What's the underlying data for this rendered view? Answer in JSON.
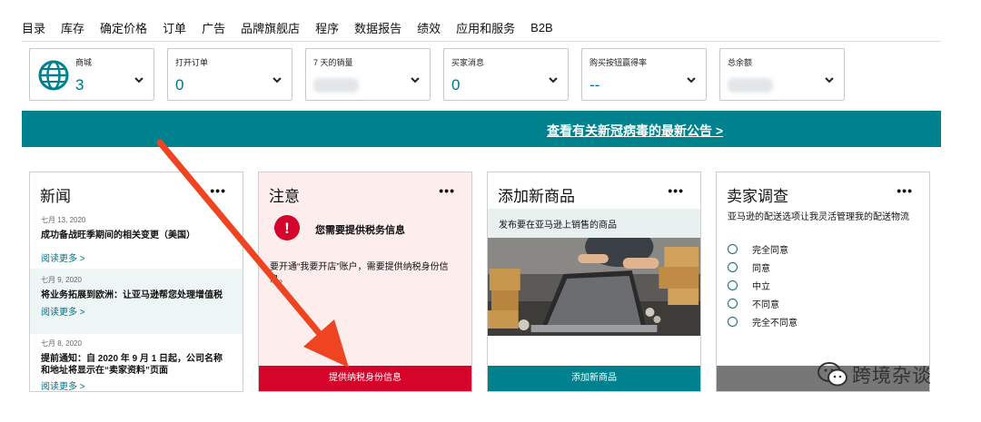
{
  "nav": {
    "items": [
      "目录",
      "库存",
      "确定价格",
      "订单",
      "广告",
      "品牌旗舰店",
      "程序",
      "数据报告",
      "绩效",
      "应用和服务",
      "B2B"
    ]
  },
  "metrics": {
    "marketplace": {
      "label": "商城",
      "value": "3"
    },
    "open_orders": {
      "label": "打开订单",
      "value": "0"
    },
    "sales_7d": {
      "label": "7 天的销量"
    },
    "buyer_messages": {
      "label": "买家消息",
      "value": "0"
    },
    "buybox": {
      "label": "购买按钮赢得率",
      "value": "--"
    },
    "balance": {
      "label": "总余额"
    }
  },
  "banner": {
    "link": "查看有关新冠病毒的最新公告 >"
  },
  "cards": {
    "news": {
      "title": "新闻",
      "dots": "•••",
      "items": [
        {
          "date": "七月 13, 2020",
          "headline": "成功备战旺季期间的相关变更（美国）",
          "link": "阅读更多 >"
        },
        {
          "date": "七月 9, 2020",
          "headline": "将业务拓展到欧洲：让亚马逊帮您处理增值税",
          "link": "阅读更多 >"
        },
        {
          "date": "七月 8, 2020",
          "headline": "提前通知：自 2020 年 9 月 1 日起，公司名称和地址将显示在“卖家资料”页面",
          "link": "阅读更多 >"
        }
      ]
    },
    "notice": {
      "title": "注意",
      "dots": "•••",
      "icon_text": "!",
      "heading": "您需要提供税务信息",
      "body": "要开通“我要开店”账户，需要提供纳税身份信息。",
      "button": "提供纳税身份信息"
    },
    "add_product": {
      "title": "添加新商品",
      "dots": "•••",
      "desc": "发布要在亚马逊上销售的商品",
      "button": "添加新商品"
    },
    "survey": {
      "title": "卖家调查",
      "dots": "•••",
      "question": "亚马逊的配送选项让我灵活管理我的配送物流",
      "options": [
        "完全同意",
        "同意",
        "中立",
        "不同意",
        "完全不同意"
      ]
    }
  },
  "colors": {
    "teal": "#00828e",
    "link": "#007185",
    "red": "#d4042a",
    "arrow": "#ee4422"
  },
  "watermark": {
    "text": "跨境杂谈"
  }
}
